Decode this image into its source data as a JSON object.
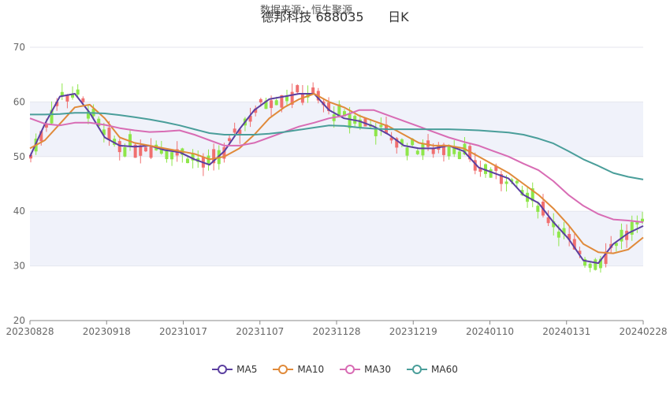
{
  "watermark": "数据来源：恒生聚源",
  "chart_data": {
    "type": "candlestick",
    "title": "德邦科技 688035      日K",
    "ylim": [
      20,
      70
    ],
    "yticks": [
      20,
      30,
      40,
      50,
      60,
      70
    ],
    "xticks": [
      "20230828",
      "20230918",
      "20231017",
      "20231107",
      "20231128",
      "20231219",
      "20240110",
      "20240131",
      "20240228"
    ],
    "grid": true,
    "legend_position": "bottom",
    "colors": {
      "up": "#f07070",
      "down": "#8ee64a",
      "MA5": "#5b3fa0",
      "MA10": "#e08a3a",
      "MA30": "#d86cb4",
      "MA60": "#4a9e9a",
      "band": "#f0f2fa"
    },
    "series": [
      {
        "name": "MA5",
        "x": [
          "20230828",
          "20230831",
          "20230905",
          "20230908",
          "20230913",
          "20230918",
          "20230922",
          "20230927",
          "20231009",
          "20231013",
          "20231017",
          "20231020",
          "20231025",
          "20231030",
          "20231102",
          "20231107",
          "20231110",
          "20231115",
          "20231120",
          "20231124",
          "20231128",
          "20231201",
          "20231206",
          "20231211",
          "20231214",
          "20231219",
          "20231222",
          "20231227",
          "20240102",
          "20240105",
          "20240110",
          "20240115",
          "20240118",
          "20240123",
          "20240126",
          "20240131",
          "20240205",
          "20240208",
          "20240215",
          "20240220",
          "20240223",
          "20240228"
        ],
        "values": [
          50,
          56,
          61,
          61.5,
          58,
          53.5,
          52,
          51.8,
          52,
          51.2,
          50.8,
          49.5,
          48.5,
          51,
          55,
          58.5,
          60.5,
          61,
          61.5,
          61.5,
          58.5,
          57,
          56.5,
          55.5,
          54,
          52,
          51.5,
          51.5,
          52,
          51,
          48,
          47,
          46,
          43,
          41.5,
          38,
          35,
          31,
          30.5,
          34,
          36,
          37.3
        ]
      },
      {
        "name": "MA10",
        "x": [
          "20230828",
          "20230831",
          "20230905",
          "20230908",
          "20230913",
          "20230918",
          "20230922",
          "20230927",
          "20231009",
          "20231013",
          "20231017",
          "20231020",
          "20231025",
          "20231030",
          "20231102",
          "20231107",
          "20231110",
          "20231115",
          "20231120",
          "20231124",
          "20231128",
          "20231201",
          "20231206",
          "20231211",
          "20231214",
          "20231219",
          "20231222",
          "20231227",
          "20240102",
          "20240105",
          "20240110",
          "20240115",
          "20240118",
          "20240123",
          "20240126",
          "20240131",
          "20240205",
          "20240208",
          "20240215",
          "20240220",
          "20240223",
          "20240228"
        ],
        "values": [
          51.5,
          53,
          56,
          59,
          59.5,
          57,
          53.5,
          52.5,
          52,
          51.5,
          51,
          50.5,
          49.5,
          50,
          51.5,
          54,
          57,
          59,
          60.5,
          61.5,
          60,
          59,
          57.5,
          56.5,
          55.5,
          54,
          52.5,
          52,
          52,
          51.5,
          50,
          48.5,
          47,
          45,
          43,
          40.5,
          37.5,
          34,
          32.5,
          32.3,
          33,
          35.2
        ]
      },
      {
        "name": "MA30",
        "x": [
          "20230828",
          "20230831",
          "20230905",
          "20230908",
          "20230913",
          "20230918",
          "20230922",
          "20230927",
          "20231009",
          "20231013",
          "20231017",
          "20231020",
          "20231025",
          "20231030",
          "20231102",
          "20231107",
          "20231110",
          "20231115",
          "20231120",
          "20231124",
          "20231128",
          "20231201",
          "20231206",
          "20231211",
          "20231214",
          "20231219",
          "20231222",
          "20231227",
          "20240102",
          "20240105",
          "20240110",
          "20240115",
          "20240118",
          "20240123",
          "20240126",
          "20240131",
          "20240205",
          "20240208",
          "20240215",
          "20240220",
          "20240223",
          "20240228"
        ],
        "values": [
          57,
          56,
          55.7,
          56.2,
          56.2,
          55.8,
          55.2,
          54.8,
          54.5,
          54.6,
          54.8,
          54,
          53,
          52,
          52,
          52.5,
          53.5,
          54.5,
          55.5,
          56.2,
          57,
          57.5,
          58.5,
          58.5,
          57.5,
          56.5,
          55.5,
          54.5,
          53.5,
          52.7,
          52,
          51,
          50,
          48.7,
          47.5,
          45.5,
          43,
          41,
          39.5,
          38.5,
          38.3,
          38
        ]
      },
      {
        "name": "MA60",
        "x": [
          "20230828",
          "20230831",
          "20230905",
          "20230908",
          "20230913",
          "20230918",
          "20230922",
          "20230927",
          "20231009",
          "20231013",
          "20231017",
          "20231020",
          "20231025",
          "20231030",
          "20231102",
          "20231107",
          "20231110",
          "20231115",
          "20231120",
          "20231124",
          "20231128",
          "20231201",
          "20231206",
          "20231211",
          "20231214",
          "20231219",
          "20231222",
          "20231227",
          "20240102",
          "20240105",
          "20240110",
          "20240115",
          "20240118",
          "20240123",
          "20240126",
          "20240131",
          "20240205",
          "20240208",
          "20240215",
          "20240220",
          "20240223",
          "20240228"
        ],
        "values": [
          57.7,
          57.7,
          57.8,
          58,
          58,
          57.9,
          57.6,
          57.2,
          56.8,
          56.3,
          55.7,
          55,
          54.3,
          54,
          54,
          54,
          54.2,
          54.5,
          54.9,
          55.3,
          55.7,
          55.6,
          55.3,
          55.1,
          55,
          55,
          55,
          55,
          55,
          54.9,
          54.8,
          54.6,
          54.4,
          54,
          53.3,
          52.4,
          51,
          49.5,
          48.3,
          47,
          46.3,
          45.8
        ]
      }
    ]
  },
  "legend": [
    {
      "label": "MA5",
      "color": "#5b3fa0"
    },
    {
      "label": "MA10",
      "color": "#e08a3a"
    },
    {
      "label": "MA30",
      "color": "#d86cb4"
    },
    {
      "label": "MA60",
      "color": "#4a9e9a"
    }
  ]
}
